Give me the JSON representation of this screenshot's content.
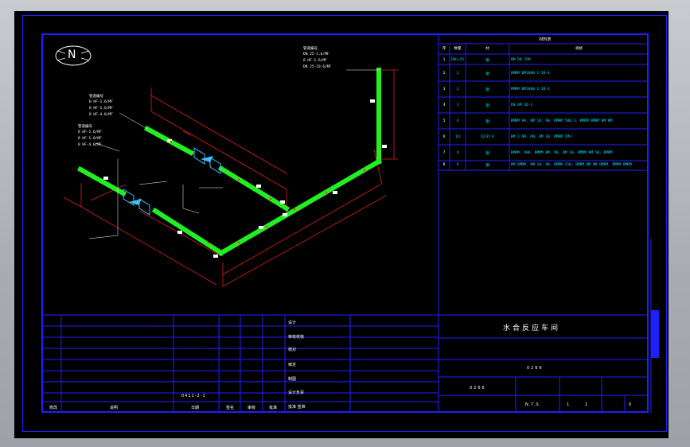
{
  "north_label": "N",
  "table": {
    "title": "材料表",
    "headers": [
      "序",
      "数量",
      "材",
      "规格"
    ],
    "rows": [
      {
        "no": "1",
        "qty": "DN~25",
        "mat": "钢",
        "spec": "BM DN 25M"
      },
      {
        "no": "2",
        "qty": "1",
        "mat": "钢",
        "spec": "BMRM BM1000-1-1D-4"
      },
      {
        "no": "3",
        "qty": "1",
        "mat": "钢",
        "spec": "BMRM BM1000-1-1D-3"
      },
      {
        "no": "4",
        "qty": "1",
        "mat": "钢",
        "spec": "DN BM 2D-1"
      },
      {
        "no": "5",
        "qty": "4",
        "mat": "钢",
        "spec": "BMRM 90, BM 18, 90, BMRM 500,3, BMRM BMRM BM BM"
      },
      {
        "no": "6",
        "qty": "10",
        "mat": "Q235 A",
        "spec": "BM 2 DN, DN, BM 10, BMRM 2M3"
      },
      {
        "no": "7",
        "qty": "4",
        "mat": "钢",
        "spec": "BMRM, 900, BMRM BM, 90, BM 10, BMRM BM 50, BMRM"
      },
      {
        "no": "8",
        "qty": "6",
        "mat": "钢",
        "spec": "BM BMRM, BM 10, 90, BMRM 250, BMRM BM BM BMRM, BMRM BMRM"
      }
    ]
  },
  "titleblock": {
    "project": "水合反应车间",
    "drawing_no": "0266",
    "sub_no": "0266",
    "scale": "N.T.S.",
    "sheet": "1",
    "of": "1",
    "rev": "0",
    "left_code": "0411-2-1",
    "labels_left": [
      "修改",
      "说明",
      "日期",
      "签名",
      "审核",
      "批准"
    ],
    "labels_mid": [
      "设计",
      "审核校核",
      "核对",
      "审定",
      "制图",
      "设计负责",
      "批准 签准"
    ]
  },
  "annotations": {
    "a1": [
      "管道编号",
      "DN 25-1.6/MF",
      "8 HF-1.6/MF",
      "DN 25-19.6/MF"
    ],
    "a2": [
      "管道编号",
      "B HF-1.6/MF",
      "8 HF-1.6/MF",
      "8 HF-4.0/MF"
    ],
    "a3": [
      "管道编号",
      "8 HF-1.6/MF",
      "8 HF-1.0/MF",
      "8 HF-4.0/MF"
    ]
  }
}
